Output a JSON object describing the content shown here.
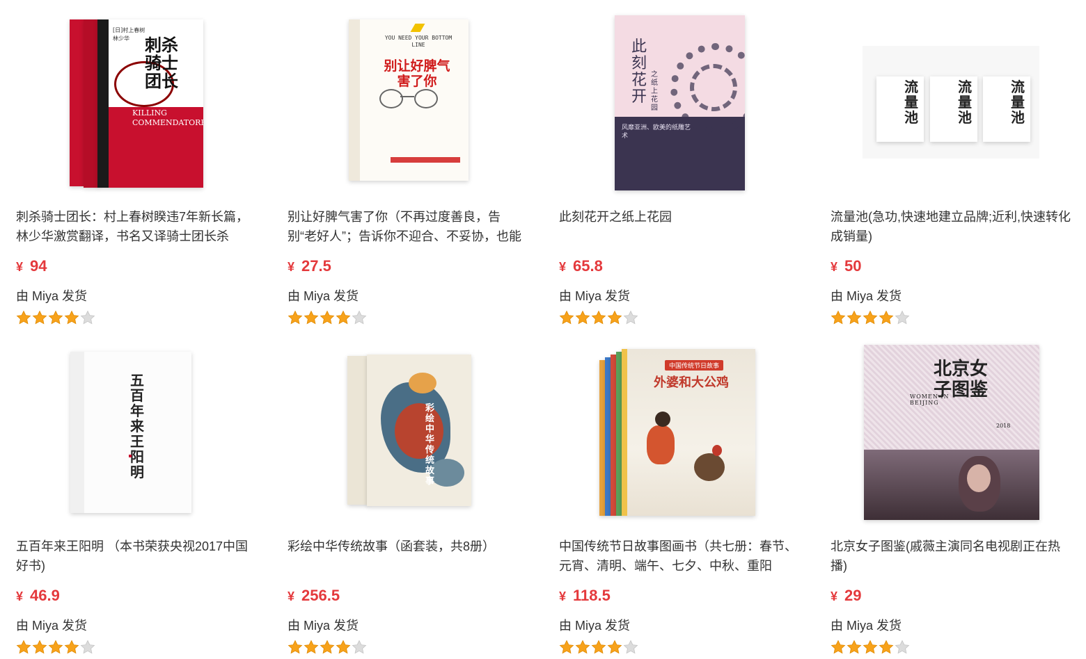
{
  "products": [
    {
      "title": "刺杀骑士团长：村上春树睽违7年新长篇，林少华激赏翻译，书名又译骑士团长杀",
      "currency": "¥",
      "price": "94",
      "shipper": "由 Miya 发货",
      "rating": 4,
      "cover": {
        "title": "刺杀骑士团长",
        "subtitle": "KILLING COMMENDATORE",
        "author": "[日]村上春树",
        "translator": "林少华"
      }
    },
    {
      "title": "别让好脾气害了你（不再过度善良，告别“老好人”；告诉你不迎合、不妥协，也能拥",
      "currency": "¥",
      "price": "27.5",
      "shipper": "由 Miya 发货",
      "rating": 4,
      "cover": {
        "title": "别让好脾气害了你",
        "subtitle": "YOU NEED YOUR BOTTOM LINE"
      }
    },
    {
      "title": "此刻花开之纸上花园",
      "currency": "¥",
      "price": "65.8",
      "shipper": "由 Miya 发货",
      "rating": 4,
      "cover": {
        "title": "此刻花开",
        "subtitle": "之纸上花园",
        "tagline": "风靡亚洲、欧美的纸雕艺术"
      }
    },
    {
      "title": "流量池(急功,快速地建立品牌;近利,快速转化成销量)",
      "currency": "¥",
      "price": "50",
      "shipper": "由 Miya 发货",
      "rating": 4,
      "cover": {
        "title": "流量池"
      }
    },
    {
      "title": "五百年来王阳明 （本书荣获央视2017中国好书)",
      "currency": "¥",
      "price": "46.9",
      "shipper": "由 Miya 发货",
      "rating": 4,
      "cover": {
        "title": "五百年来王阳明"
      }
    },
    {
      "title": "彩绘中华传统故事（函套装，共8册）",
      "currency": "¥",
      "price": "256.5",
      "shipper": "由 Miya 发货",
      "rating": 4,
      "cover": {
        "title": "彩绘中华传统故事"
      }
    },
    {
      "title": "中国传统节日故事图画书（共七册：春节、元宵、清明、端午、七夕、中秋、重阳",
      "currency": "¥",
      "price": "118.5",
      "shipper": "由 Miya 发货",
      "rating": 4,
      "cover": {
        "title": "外婆和大公鸡",
        "series": "中国传统节日故事"
      }
    },
    {
      "title": "北京女子图鉴(戚薇主演同名电视剧正在热播)",
      "currency": "¥",
      "price": "29",
      "shipper": "由 Miya 发货",
      "rating": 4,
      "cover": {
        "title": "北京女子图鉴",
        "subtitle": "WOMEN IN BEIJING",
        "year": "2018"
      }
    }
  ],
  "colors": {
    "price": "#e4393c",
    "star_on": "#f7a21b",
    "star_off": "#dcdcdc"
  }
}
